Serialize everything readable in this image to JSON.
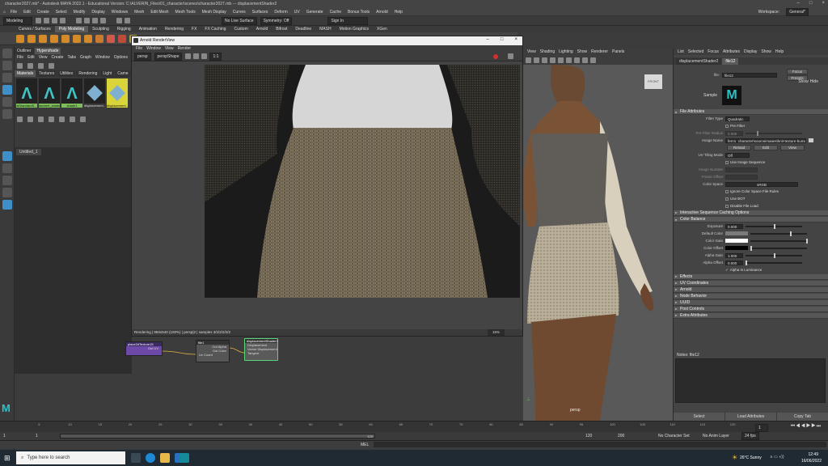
{
  "window": {
    "title": "character2027.mb* - Autodesk MAYA 2022.1 - Educational Version: C:\\ALVERIN_Files\\01_character\\scenes\\character2027.mb --- displacementShader2",
    "controls": [
      "–",
      "□",
      "×"
    ]
  },
  "menubar": [
    "File",
    "Edit",
    "Create",
    "Select",
    "Modify",
    "Display",
    "Windows",
    "Mesh",
    "Edit Mesh",
    "Mesh Tools",
    "Mesh Display",
    "Curves",
    "Surfaces",
    "Deform",
    "UV",
    "Generate",
    "Cache",
    "Bonus Tools",
    "Arnold",
    "Help"
  ],
  "statusline": {
    "mode": "Modeling",
    "live_surface": "No Live Surface",
    "symmetry": "Symmetry: Off",
    "sign_in": "Sign In",
    "workspace_label": "Workspace:",
    "workspace": "General*"
  },
  "shelf": {
    "tabs": [
      "Curves / Surfaces",
      "Poly Modeling",
      "Sculpting",
      "Rigging",
      "Animation",
      "Rendering",
      "FX",
      "FX Caching",
      "Custom",
      "Arnold",
      "Bifrost",
      "Deadline",
      "MASH",
      "Motion Graphics",
      "XGen"
    ],
    "active_tab": "Poly Modeling"
  },
  "hypershade": {
    "tabs": [
      "Outliner",
      "Hypershade"
    ],
    "menu": [
      "File",
      "Edit",
      "View",
      "Create",
      "Tabs",
      "Graph",
      "Window",
      "Options"
    ],
    "browser_tabs": [
      "Materials",
      "Textures",
      "Utilities",
      "Rendering",
      "Light",
      "Came"
    ],
    "swatches": [
      {
        "label": "aiStandardS...",
        "color": "green"
      },
      {
        "label": "lambert_shader",
        "color": "green"
      },
      {
        "label": "shade1",
        "color": "green"
      },
      {
        "label": "displacement...",
        "color": "none"
      },
      {
        "label": "displacement...",
        "color": "yellow"
      }
    ],
    "graph_tab": "Untitled_1"
  },
  "renderview": {
    "title": "Arnold RenderView",
    "menu": [
      "File",
      "Window",
      "View",
      "Render"
    ],
    "camera": "persp",
    "display": "perspShape",
    "zoom": "1:1",
    "status": "Rendering | 960x540 (100%) | persp|2 | samples 3/2/2/2/2/2",
    "zoom_pct": "15%"
  },
  "nodegraph": {
    "nodes": [
      {
        "name": "place2dTexture15",
        "port": "Out UV"
      },
      {
        "name": "file1",
        "ports": [
          "Out Alpha",
          "Out Color",
          "Uv Coord"
        ]
      },
      {
        "name": "displacementShader2",
        "ports": [
          "Displacement",
          "Vector Displacement",
          "Tangent"
        ]
      }
    ]
  },
  "viewport": {
    "menu": [
      "View",
      "Shading",
      "Lighting",
      "Show",
      "Renderer",
      "Panels"
    ],
    "cube_label": "FRONT",
    "camera_label": "persp"
  },
  "attribute_editor": {
    "menu": [
      "List",
      "Selected",
      "Focus",
      "Attributes",
      "Display",
      "Show",
      "Help"
    ],
    "tabs": [
      "displacementShader2",
      "file12"
    ],
    "active_tab": "file12",
    "file_label": "file:",
    "file_name": "file12",
    "buttons": {
      "focus": "Focus",
      "presets": "Presets",
      "show": "Show",
      "hide": "Hide"
    },
    "sample_label": "Sample",
    "sections": {
      "file_attributes": "File Attributes",
      "interactive": "Interactive Sequence Caching Options",
      "color_balance": "Color Balance",
      "effects": "Effects",
      "uv_coordinates": "UV Coordinates",
      "arnold": "Arnold",
      "node_behavior": "Node Behavior",
      "uuid": "UUID",
      "post_controls": "Post Controls",
      "extra_attributes": "Extra Attributes"
    },
    "file_attrs": {
      "filter_type_label": "Filter Type",
      "filter_type": "Quadratic",
      "pre_filter": "Pre Filter",
      "pre_filter_radius_label": "Pre Filter Radius",
      "pre_filter_radius": "2.000",
      "image_name_label": "Image Name",
      "image_name": "fern1_character\\sourceimages\\knit-texture-bump.png",
      "reload": "Reload",
      "edit": "Edit",
      "view": "View",
      "uv_tiling_label": "UV Tiling Mode",
      "uv_tiling": "Off",
      "use_sequence": "Use Image Sequence",
      "image_number_label": "Image Number",
      "frame_offset_label": "Frame Offset",
      "color_space_label": "Color Space",
      "color_space": "sRGB",
      "ignore_cs": "Ignore Color Space File Rules",
      "use_bot": "Use BOT",
      "disable_load": "Disable File Load"
    },
    "color_balance": {
      "exposure_label": "Exposure",
      "exposure": "0.000",
      "default_color_label": "Default Color",
      "color_gain_label": "Color Gain",
      "color_offset_label": "Color Offset",
      "alpha_gain_label": "Alpha Gain",
      "alpha_gain": "1.000",
      "alpha_offset_label": "Alpha Offset",
      "alpha_offset": "0.000",
      "alpha_luminance": "Alpha Is Luminance"
    },
    "notes_label": "Notes: file12",
    "bottom_buttons": [
      "Select",
      "Load Attributes",
      "Copy Tab"
    ]
  },
  "timeline": {
    "ticks": [
      "5",
      "10",
      "15",
      "20",
      "25",
      "30",
      "35",
      "40",
      "45",
      "50",
      "55",
      "60",
      "65",
      "70",
      "75",
      "80",
      "85",
      "90",
      "95",
      "100",
      "105",
      "110",
      "115",
      "120"
    ],
    "current_frame": "1",
    "range_start": "1",
    "range_start2": "1",
    "range_end_inner": "120",
    "range_end": "120",
    "range_end2": "200",
    "character_set": "No Character Set",
    "anim_layer": "No Anim Layer",
    "fps": "24 fps"
  },
  "cmdline": {
    "lang": "MEL"
  },
  "taskbar": {
    "search_placeholder": "Type here to search",
    "weather": "26°C  Sunny",
    "time": "12:49",
    "date": "16/06/2022"
  }
}
